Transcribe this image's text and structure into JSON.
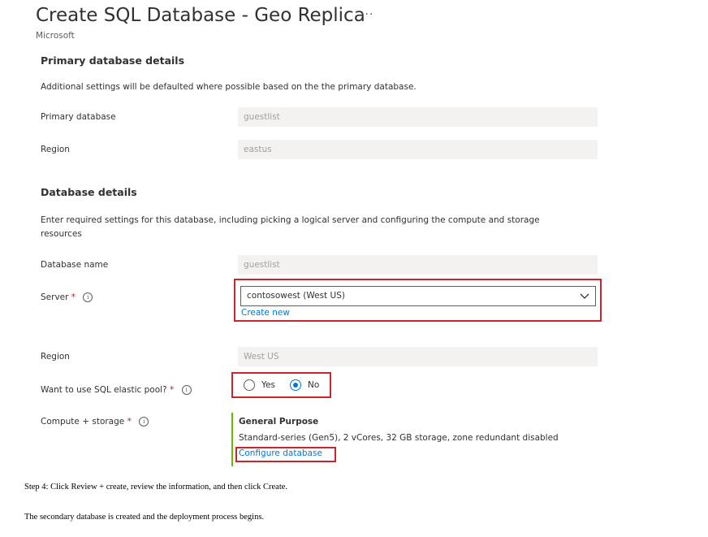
{
  "header": {
    "title": "Create SQL Database - Geo Replica",
    "more_icon": "ellipsis-icon",
    "more_label": "···",
    "publisher": "Microsoft"
  },
  "primary_section": {
    "heading": "Primary database details",
    "description": "Additional settings will be defaulted where possible based on the the primary database.",
    "fields": {
      "primary_database": {
        "label": "Primary database",
        "value": "guestlist"
      },
      "region": {
        "label": "Region",
        "value": "eastus"
      }
    }
  },
  "database_section": {
    "heading": "Database details",
    "description_line1": "Enter required settings for this database, including picking a logical server and configuring the compute and storage",
    "description_line2": "resources",
    "database_name": {
      "label": "Database name",
      "value": "guestlist"
    },
    "server": {
      "label": "Server",
      "required_mark": "*",
      "info_icon": "info-icon",
      "selected": "contosowest (West US)",
      "create_new": "Create new"
    },
    "region": {
      "label": "Region",
      "value": "West US"
    },
    "elastic_pool": {
      "label": "Want to use SQL elastic pool?",
      "required_mark": "*",
      "options": [
        "Yes",
        "No"
      ],
      "selected": "No"
    },
    "compute_storage": {
      "label": "Compute + storage",
      "required_mark": "*",
      "tier": "General Purpose",
      "details": "Standard-series (Gen5), 2 vCores, 32 GB storage, zone redundant disabled",
      "configure_link": "Configure database"
    }
  },
  "document": {
    "step4": "Step 4: Click Review + create, review the information, and then click Create.",
    "result": "The secondary database is created and the deployment process begins."
  },
  "colors": {
    "highlight_border": "#c4262e",
    "link": "#0078d4",
    "required": "#a4262c",
    "accent_bar": "#6bb700"
  }
}
